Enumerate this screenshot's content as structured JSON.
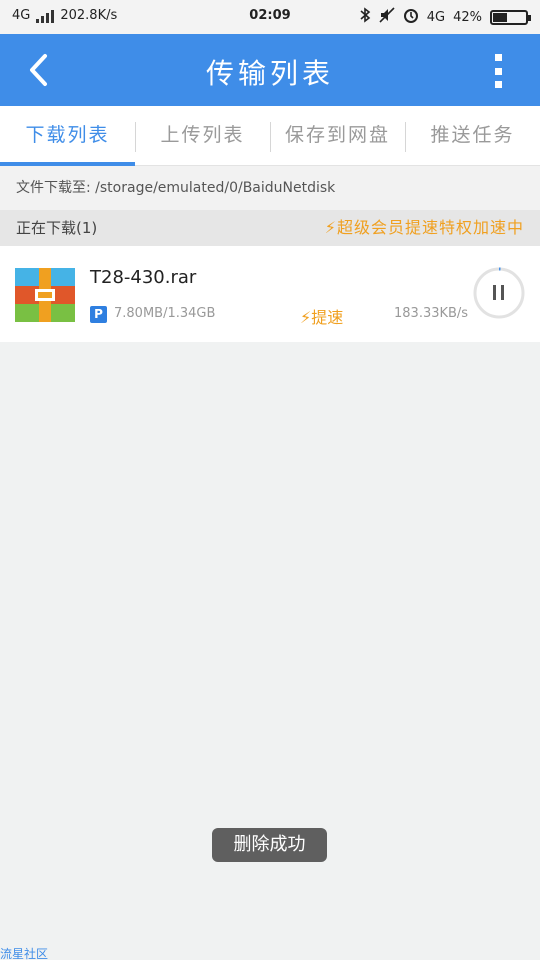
{
  "status_bar": {
    "network_left": "4G",
    "net_speed": "202.8K/s",
    "time": "02:09",
    "network_right": "4G",
    "battery": "42%",
    "battery_level": 0.42,
    "icons": [
      "signal-icon",
      "bluetooth-icon",
      "mute-icon",
      "alarm-icon",
      "battery-icon"
    ]
  },
  "header": {
    "title": "传输列表",
    "background_color": "#3f8de8"
  },
  "tabs": [
    {
      "label": "下载列表",
      "active": true
    },
    {
      "label": "上传列表",
      "active": false
    },
    {
      "label": "保存到网盘",
      "active": false
    },
    {
      "label": "推送任务",
      "active": false
    }
  ],
  "path_bar": {
    "text": "文件下载至: /storage/emulated/0/BaiduNetdisk"
  },
  "section": {
    "title": "正在下载(1)",
    "vip_text": "⚡超级会员提速特权加速中"
  },
  "downloads": [
    {
      "name": "T28-430.rar",
      "badge": "P",
      "progress": "7.80MB/1.34GB",
      "speedup": "⚡提速",
      "speed": "183.33KB/s"
    }
  ],
  "toast": {
    "text": "删除成功"
  },
  "watermark": {
    "text": "流星社区"
  },
  "colors": {
    "accent": "#3f8de8",
    "vip_orange": "#f0a020"
  }
}
